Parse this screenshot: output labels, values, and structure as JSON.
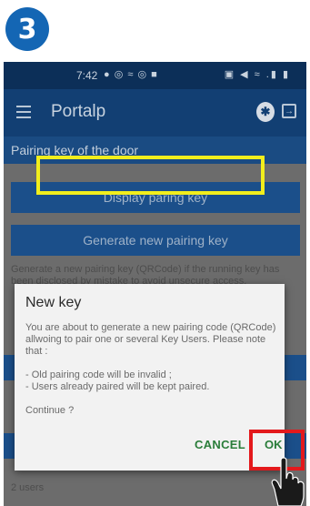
{
  "step_badge": "3",
  "status_bar": {
    "time": "7:42",
    "left_icons": "● ◎ ≈ ◎ ■",
    "right_icons": "▣ ◀ ≈ .▮ ▮"
  },
  "app_bar": {
    "title": "Portalp",
    "menu_icon": "menu-icon",
    "bluetooth_icon": "bluetooth-icon",
    "exit_icon": "exit-icon"
  },
  "section": {
    "title": "Pairing key of the door"
  },
  "buttons": {
    "display_key": "Display paring key",
    "generate_key": "Generate new pairing key"
  },
  "background_text": {
    "description": "Generate a new pairing key (QRCode) if the running key has been disclosed by mistake to avoid unsecure access.",
    "footer": "2 users"
  },
  "dialog": {
    "title": "New key",
    "intro": "You are about to generate a new pairing code (QRCode) allwoing to pair one or several Key Users. Please note that :",
    "note_1": "- Old pairing code will be invalid ;",
    "note_2": "- Users already paired will be kept paired.",
    "question": "Continue ?",
    "cancel_label": "CANCEL",
    "ok_label": "OK"
  },
  "colors": {
    "badge": "#1466b4",
    "app_bar": "#123f73",
    "highlight_generate": "#f2ee1c",
    "highlight_ok": "#e3191c",
    "dialog_action": "#2a7d3a"
  }
}
